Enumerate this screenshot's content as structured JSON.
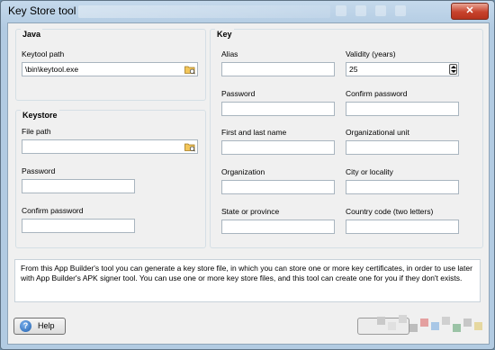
{
  "window": {
    "title": "Key Store tool",
    "close_glyph": "✕"
  },
  "java": {
    "group_label": "Java",
    "keytool_path_label": "Keytool path",
    "keytool_path_value": "\\bin\\keytool.exe",
    "browse_icon": "folder-browse-icon"
  },
  "keystore": {
    "group_label": "Keystore",
    "file_path_label": "File path",
    "file_path_value": "",
    "password_label": "Password",
    "confirm_password_label": "Confirm password",
    "browse_icon": "folder-browse-icon"
  },
  "key": {
    "group_label": "Key",
    "alias_label": "Alias",
    "validity_label": "Validity (years)",
    "validity_value": "25",
    "password_label": "Password",
    "confirm_password_label": "Confirm password",
    "first_last_name_label": "First and last name",
    "org_unit_label": "Organizational unit",
    "organization_label": "Organization",
    "city_label": "City or locality",
    "state_label": "State or province",
    "country_label": "Country code (two letters)"
  },
  "info_text": "From this App Builder's tool you can generate a key store file, in which you can store one or more key certificates, in order to use later with App Builder's APK signer tool. You can use one or more key store files, and this tool can create one for you if they don't exists.",
  "footer": {
    "help_label": "Help",
    "help_icon": "question-icon"
  },
  "colors": {
    "titlebar": "#b2cbe2",
    "close_button": "#c7422c",
    "client_bg": "#f0f0f0"
  }
}
